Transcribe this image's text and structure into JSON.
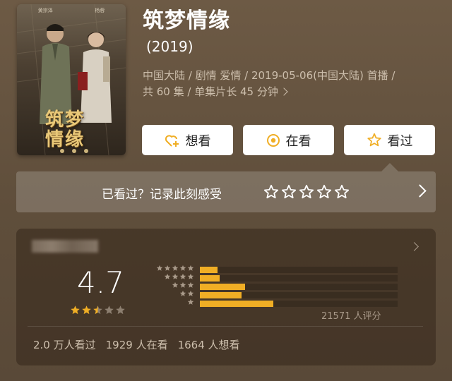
{
  "poster": {
    "credits": [
      "黄宗泽",
      "杨蓉"
    ],
    "calligraphy": [
      "筑梦",
      "情缘"
    ]
  },
  "title": "筑梦情缘",
  "year": "(2019)",
  "meta": {
    "line1": "中国大陆 / 剧情 爱情 / 2019-05-06(中国大陆) 首播 /",
    "line2": "共 60 集 / 单集片长 45 分钟"
  },
  "actions": {
    "want": "想看",
    "watching": "在看",
    "watched": "看过"
  },
  "rate_prompt": "已看过？记录此刻感受",
  "rating": {
    "score": "4.7",
    "stars_filled": 2.5,
    "stars_total": 5,
    "distribution": [
      {
        "stars": 5,
        "fraction": 0.09
      },
      {
        "stars": 4,
        "fraction": 0.1
      },
      {
        "stars": 3,
        "fraction": 0.23
      },
      {
        "stars": 2,
        "fraction": 0.21
      },
      {
        "stars": 1,
        "fraction": 0.37
      }
    ],
    "count_label": "21571 人评分"
  },
  "stats": {
    "watched": "2.0 万人看过",
    "watching": "1929 人在看",
    "want": "1664 人想看"
  },
  "colors": {
    "accent": "#f0ae25",
    "background": "#6d5a45"
  }
}
